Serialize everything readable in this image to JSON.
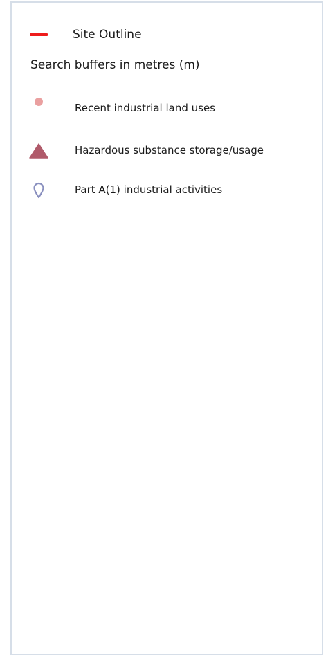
{
  "legend": {
    "site_outline": {
      "label": "Site Outline",
      "color": "#ee1c1c"
    },
    "heading": "Search buffers in metres (m)",
    "items": [
      {
        "label": "Recent industrial land uses",
        "icon": "circle-marker-icon",
        "color": "#eaa0a0"
      },
      {
        "label": "Hazardous substance storage/usage",
        "icon": "triangle-marker-icon",
        "color": "#b05a6a"
      },
      {
        "label": "Part A(1) industrial activities",
        "icon": "pin-outline-icon",
        "color": "#8a90bf"
      }
    ]
  }
}
